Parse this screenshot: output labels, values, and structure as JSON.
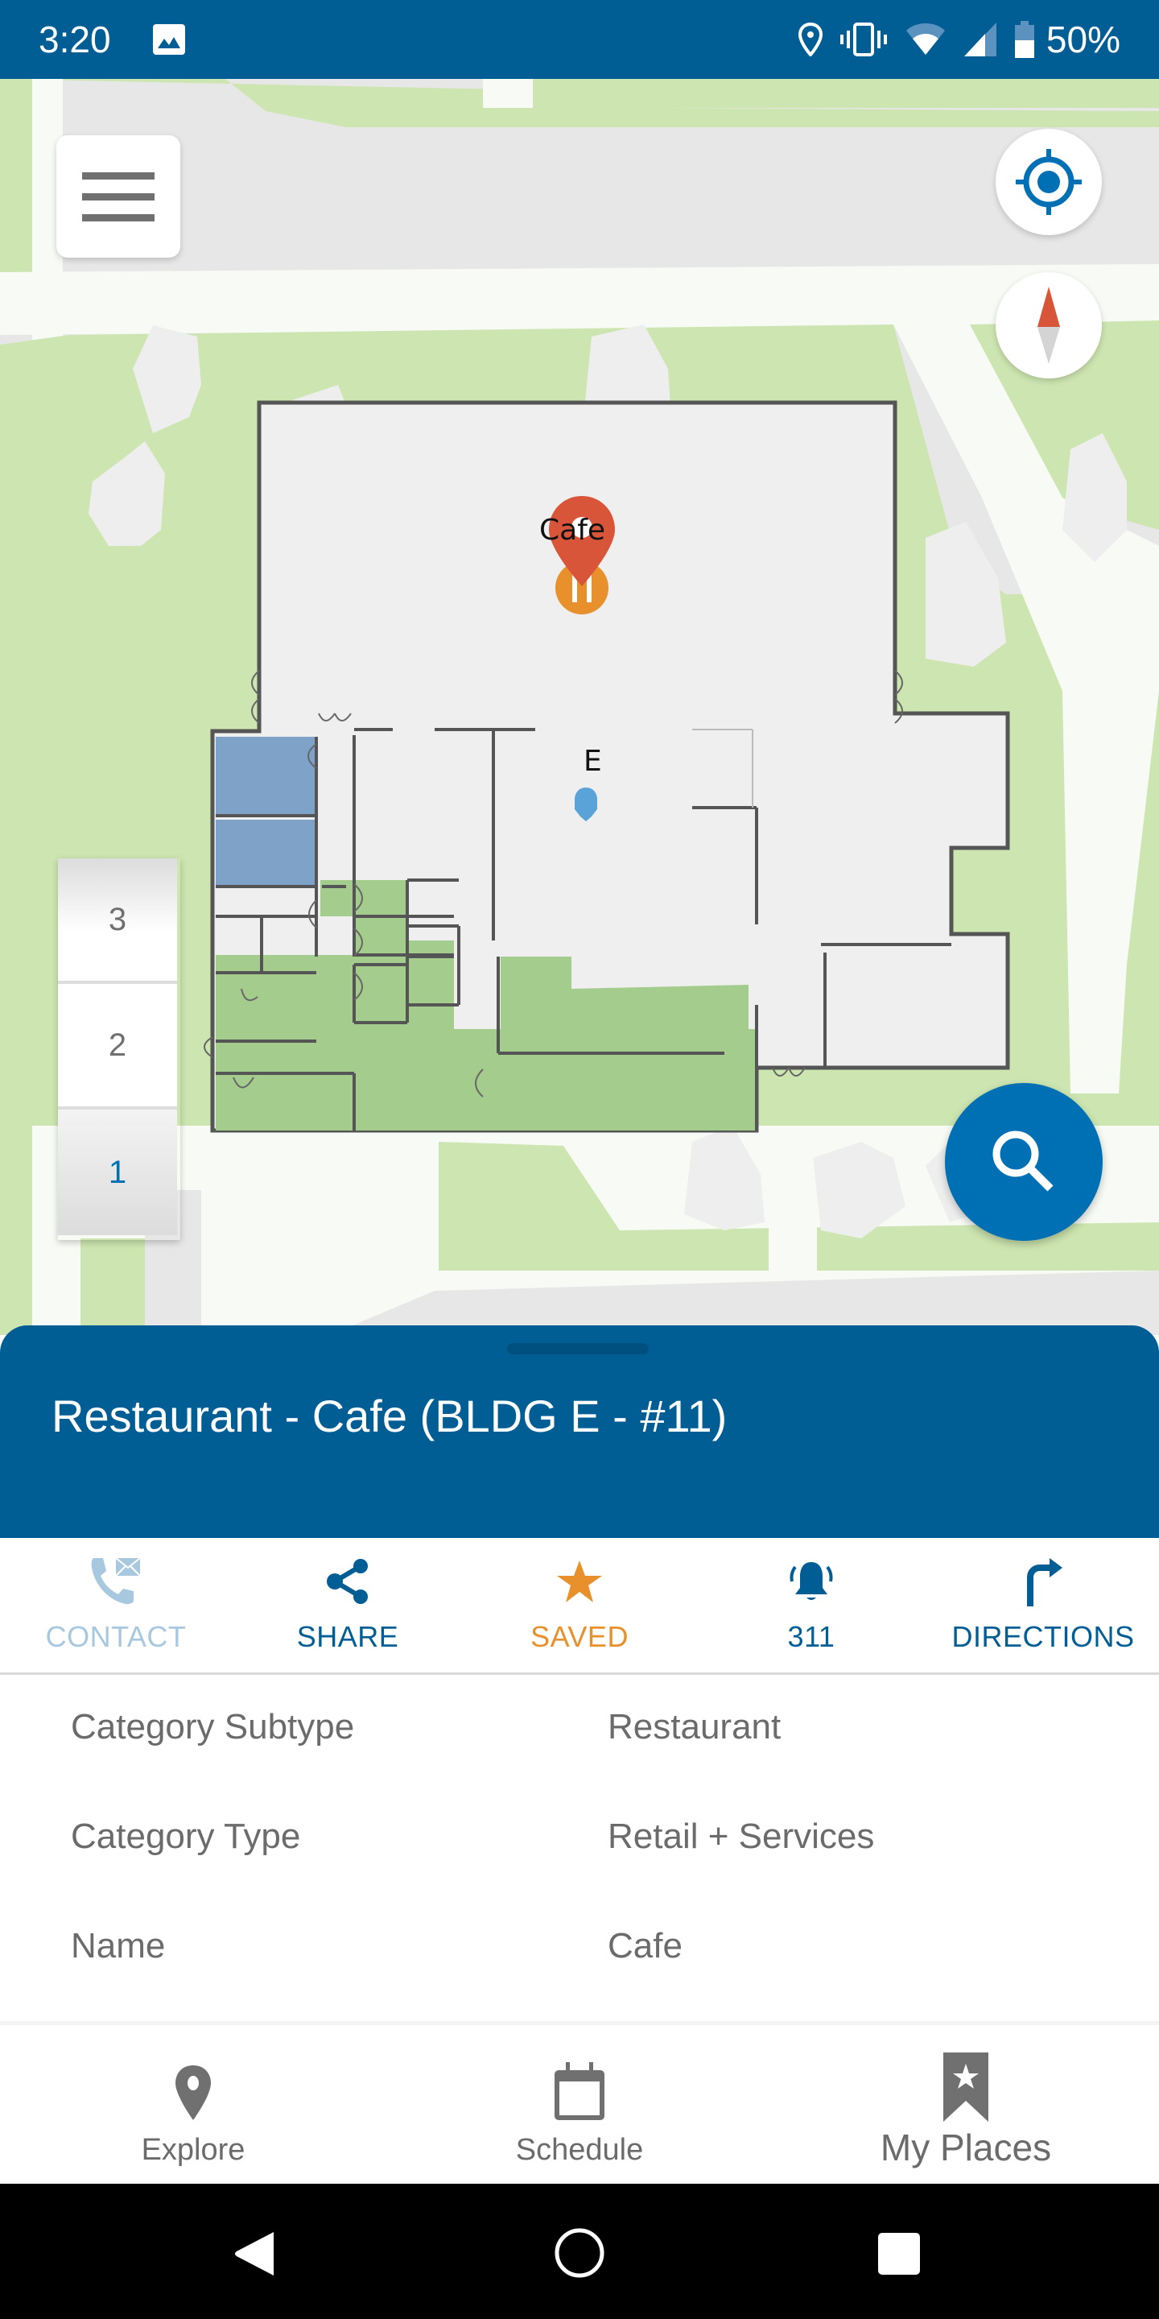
{
  "status_bar": {
    "time": "3:20",
    "battery": "50%",
    "icons": [
      "gallery-icon",
      "location-icon",
      "vibrate-icon",
      "wifi-icon",
      "cellular-signal-icon",
      "battery-icon"
    ]
  },
  "map": {
    "floors": [
      "3",
      "2",
      "1"
    ],
    "selected_floor": "1",
    "labels": {
      "poi": "Cafe",
      "building": "E"
    },
    "colors": {
      "pin": "#d9553a",
      "restaurant_badge": "#e8902c",
      "accent": "#0070b4",
      "grass": "#cde5b0",
      "floor": "#efefef"
    }
  },
  "sheet": {
    "title": "Restaurant - Cafe (BLDG E - #11)",
    "actions": [
      {
        "label": "CONTACT",
        "icon": "contact-phone-mail-icon",
        "state": "disabled"
      },
      {
        "label": "SHARE",
        "icon": "share-icon",
        "state": "enabled"
      },
      {
        "label": "SAVED",
        "icon": "star-icon",
        "state": "active"
      },
      {
        "label": "311",
        "icon": "bell-ringing-icon",
        "state": "enabled"
      },
      {
        "label": "DIRECTIONS",
        "icon": "turn-right-arrow-icon",
        "state": "enabled"
      }
    ],
    "details": [
      {
        "key": "Category Subtype",
        "value": "Restaurant"
      },
      {
        "key": "Category Type",
        "value": "Retail + Services"
      },
      {
        "key": "Name",
        "value": "Cafe"
      }
    ]
  },
  "bottom_nav": {
    "items": [
      {
        "label": "Explore",
        "icon": "map-pin-icon"
      },
      {
        "label": "Schedule",
        "icon": "calendar-icon"
      },
      {
        "label": "My Places",
        "icon": "bookmark-star-icon"
      }
    ]
  },
  "colors": {
    "header_blue": "#005e95",
    "saved_orange": "#e8902c",
    "contact_disabled": "#a8c8df"
  }
}
